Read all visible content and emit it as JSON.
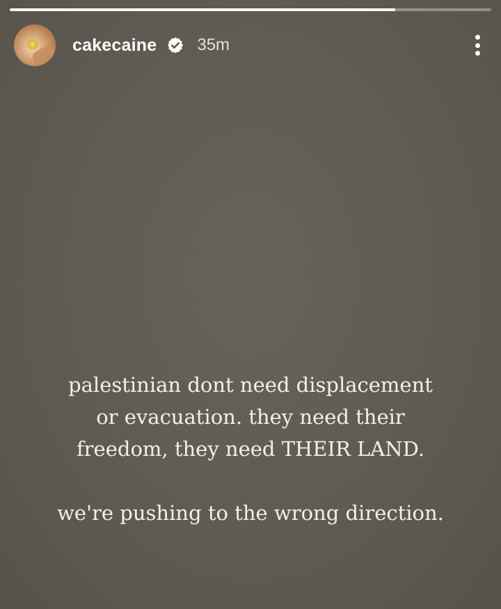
{
  "story": {
    "progress": 0.8,
    "progress_fill_color": "#ffffff",
    "background_color": "#5f5b52"
  },
  "header": {
    "avatar_icon": "profile-avatar-flower",
    "username": "cakecaine",
    "verified_icon": "verified-badge-icon",
    "time_ago": "35m",
    "more_icon": "more-vertical-icon"
  },
  "caption": {
    "lines": [
      "palestinian dont need displacement",
      "or evacuation. they need their",
      "freedom, they need THEIR LAND.",
      "we're pushing to the wrong direction."
    ]
  }
}
